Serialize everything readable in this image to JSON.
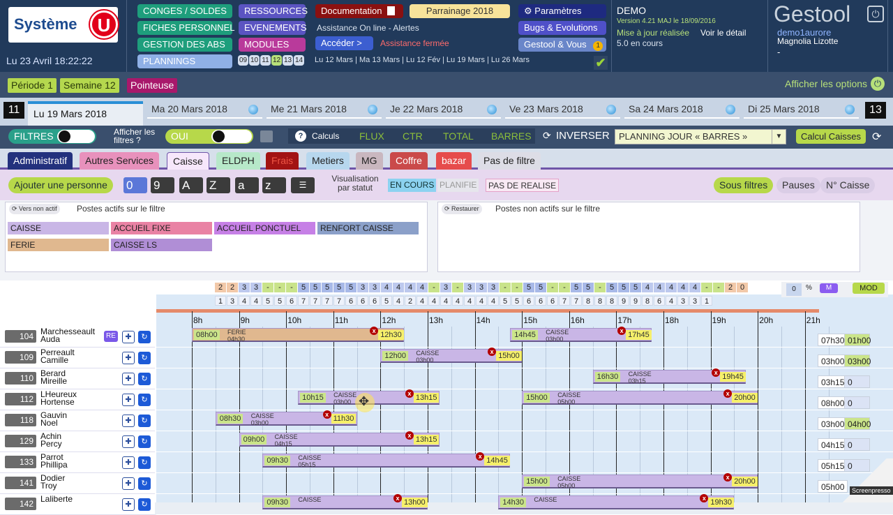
{
  "header": {
    "brand": "Système",
    "brand_u": "U",
    "datetime": "Lu 23 Avril 18:22:22",
    "menu_col1": [
      "CONGES / SOLDES",
      "FICHES PERSONNEL",
      "GESTION DES ABS",
      "PLANNINGS"
    ],
    "menu_col2": [
      "RESSOURCES",
      "EVENEMENTS",
      "MODULES"
    ],
    "documentation": "Documentation",
    "parrainage": "Parrainage 2018",
    "assistance": "Assistance On line - Alertes",
    "acceder": "Accéder >",
    "assistance_closed": "Assistance fermée",
    "day_numbers": [
      "09",
      "10",
      "11",
      "12",
      "13",
      "14"
    ],
    "week_links": "Lu 12 Mars | Ma 13 Mars | Lu 12 Fév | Lu 19 Mars | Lu 26 Mars",
    "parametres": "Paramètres",
    "bugs": "Bugs & Evolutions",
    "gestool_vous": "Gestool & Vous",
    "gestool_vous_badge": "1",
    "demo": "DEMO",
    "version": "Version 4.21 MAJ le 18/09/2016",
    "maj": "Mise à jour réalisée",
    "voir": "Voir le détail",
    "en_cours": "5.0 en cours",
    "app": "Gestool",
    "user": "demo1aurore",
    "user_name": "Magnolia Lizotte",
    "dash": "-"
  },
  "period": {
    "periode": "Période 1",
    "semaine": "Semaine 12",
    "pointeuse": "Pointeuse",
    "options": "Afficher les options"
  },
  "days": {
    "prev": "11",
    "next": "13",
    "current": "Lu 19 Mars 2018",
    "list": [
      "Ma 20 Mars 2018",
      "Me 21 Mars 2018",
      "Je 22 Mars 2018",
      "Ve 23 Mars 2018",
      "Sa 24 Mars 2018",
      "Di 25 Mars 2018"
    ]
  },
  "filters": {
    "filtres": "FILTRES",
    "afficher": "Afficher les filtres ?",
    "oui": "OUI",
    "calculs": "Calculs",
    "flux": "FLUX",
    "ctr": "CTR",
    "total": "TOTAL",
    "barres": "BARRES",
    "inverser": "INVERSER",
    "planning": "PLANNING JOUR « BARRES »",
    "calcul_caisses": "Calcul Caisses"
  },
  "tabs": [
    "Administratif",
    "Autres Services",
    "Caisse",
    "ELDPH",
    "Frais",
    "Metiers",
    "MG",
    "Coffre",
    "bazar",
    "Pas de filtre"
  ],
  "toolbar": {
    "add": "Ajouter une personne",
    "sort": [
      "0",
      "9",
      "A",
      "Z",
      "a",
      "z"
    ],
    "visualisation": "Visualisation par statut",
    "en_cours": "EN COURS",
    "planifie": "PLANIFIE",
    "pas_realise": "PAS DE REALISE",
    "sous_filtres": "Sous filtres",
    "pauses": "Pauses",
    "n_caisse": "N° Caisse"
  },
  "lists": {
    "vers_non_actif": "Vers non actif",
    "actifs": "Postes actifs sur le filtre",
    "restaurer": "Restaurer",
    "non_actifs": "Postes non actifs sur le filtre",
    "postes": [
      {
        "label": "CAISSE",
        "color": "#c9b6e6"
      },
      {
        "label": "ACCUEIL FIXE",
        "color": "#e982a4"
      },
      {
        "label": "ACCUEIL PONCTUEL",
        "color": "#c680e6"
      },
      {
        "label": "RENFORT CAISSE",
        "color": "#8ba0c9"
      },
      {
        "label": "FERIE",
        "color": "#e0b88f"
      },
      {
        "label": "CAISSE LS",
        "color": "#b08ed6"
      }
    ]
  },
  "grid": {
    "counts_top": [
      "2",
      "2",
      "3",
      "3",
      "-",
      "-",
      "-",
      "5",
      "5",
      "5",
      "5",
      "5",
      "3",
      "3",
      "4",
      "4",
      "4",
      "4",
      "-",
      "3",
      "-",
      "3",
      "3",
      "3",
      "-",
      "-",
      "5",
      "5",
      "-",
      "-",
      "5",
      "5",
      "-",
      "5",
      "5",
      "5",
      "4",
      "4",
      "4",
      "4",
      "4",
      "-",
      "-",
      "2",
      "0"
    ],
    "counts_bot": [
      "1",
      "3",
      "4",
      "4",
      "5",
      "5",
      "6",
      "7",
      "7",
      "7",
      "7",
      "6",
      "6",
      "6",
      "5",
      "4",
      "2",
      "4",
      "4",
      "4",
      "4",
      "4",
      "4",
      "4",
      "5",
      "5",
      "6",
      "6",
      "6",
      "7",
      "7",
      "8",
      "8",
      "8",
      "9",
      "9",
      "8",
      "6",
      "4",
      "3",
      "3",
      "1"
    ],
    "hours": [
      "8h",
      "9h",
      "10h",
      "11h",
      "12h",
      "13h",
      "14h",
      "15h",
      "16h",
      "17h",
      "18h",
      "19h",
      "20h",
      "21h"
    ],
    "right": {
      "pct": "0",
      "pct_unit": "%",
      "m": "M",
      "mod": "MOD"
    },
    "employees": [
      {
        "num": "104",
        "last": "Marchesseault",
        "first": "Auda",
        "re": "RE",
        "total": "07h30",
        "extra": "01h00",
        "shifts": [
          {
            "start": "08h00",
            "end": "12h30",
            "poste": "FERIE",
            "dur": "04h30"
          },
          {
            "start": "14h45",
            "end": "17h45",
            "poste": "CAISSE",
            "dur": "03h00"
          }
        ]
      },
      {
        "num": "109",
        "last": "Perreault",
        "first": "Camille",
        "total": "03h00",
        "extra": "03h00",
        "shifts": [
          {
            "start": "12h00",
            "end": "15h00",
            "poste": "CAISSE",
            "dur": "03h00"
          }
        ]
      },
      {
        "num": "110",
        "last": "Berard",
        "first": "Mireille",
        "total": "03h15",
        "extra": "0",
        "shifts": [
          {
            "start": "16h30",
            "end": "19h45",
            "poste": "CAISSE",
            "dur": "03h15"
          }
        ]
      },
      {
        "num": "112",
        "last": "LHeureux",
        "first": "Hortense",
        "total": "08h00",
        "extra": "0",
        "shifts": [
          {
            "start": "10h15",
            "end": "13h15",
            "poste": "CAISSE",
            "dur": "03h00"
          },
          {
            "start": "15h00",
            "end": "20h00",
            "poste": "CAISSE",
            "dur": "05h00"
          }
        ]
      },
      {
        "num": "118",
        "last": "Gauvin",
        "first": "Noel",
        "total": "03h00",
        "extra": "04h00",
        "shifts": [
          {
            "start": "08h30",
            "end": "11h30",
            "poste": "CAISSE",
            "dur": "03h00"
          }
        ]
      },
      {
        "num": "129",
        "last": "Achin",
        "first": "Percy",
        "total": "04h15",
        "extra": "0",
        "shifts": [
          {
            "start": "09h00",
            "end": "13h15",
            "poste": "CAISSE",
            "dur": "04h15"
          }
        ]
      },
      {
        "num": "133",
        "last": "Parrot",
        "first": "Phillipa",
        "total": "05h15",
        "extra": "0",
        "shifts": [
          {
            "start": "09h30",
            "end": "14h45",
            "poste": "CAISSE",
            "dur": "05h15"
          }
        ]
      },
      {
        "num": "141",
        "last": "Dodier",
        "first": "Troy",
        "total": "05h00",
        "extra": "",
        "shifts": [
          {
            "start": "15h00",
            "end": "20h00",
            "poste": "CAISSE",
            "dur": "05h00"
          }
        ]
      },
      {
        "num": "142",
        "last": "Laliberte",
        "first": "",
        "total": "",
        "extra": "",
        "shifts": [
          {
            "start": "09h30",
            "end": "13h00",
            "poste": "CAISSE",
            "dur": ""
          },
          {
            "start": "14h30",
            "end": "19h30",
            "poste": "CAISSE",
            "dur": ""
          }
        ]
      }
    ]
  },
  "watermark": "Screenpresso"
}
